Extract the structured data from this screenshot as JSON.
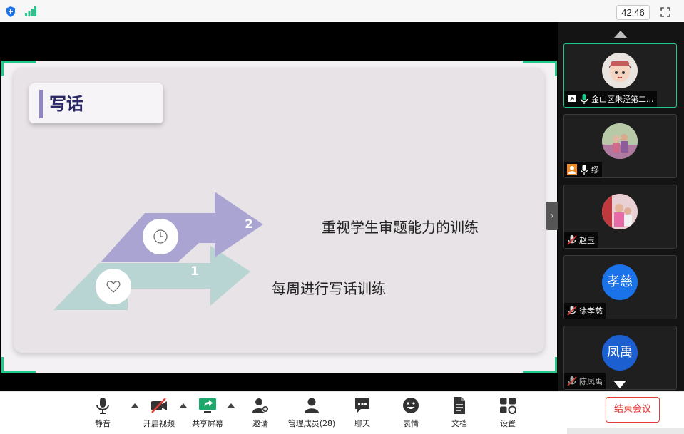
{
  "topbar": {
    "timer": "42:46",
    "icons": [
      "shield-icon",
      "signal-icon",
      "fullscreen-icon"
    ],
    "accent": "#1fc98a"
  },
  "slide": {
    "title": "写话",
    "arrow_1_number": "1",
    "arrow_2_number": "2",
    "point_1": "每周进行写话训练",
    "point_2": "重视学生审题能力的训练",
    "colors": {
      "arrow_1": "#b8d5d3",
      "arrow_2": "#aaa4d2",
      "title_bar": "#8f86c4",
      "title_text": "#2a2866"
    }
  },
  "participants": [
    {
      "name": "金山区朱泾第二...",
      "avatar": "cartoon-avatar",
      "active": true,
      "mic": "on",
      "icon": "share-icon"
    },
    {
      "name": "缪",
      "avatar": "photo-avatar",
      "active": false,
      "mic": "on",
      "icon": "host-icon"
    },
    {
      "name": "赵玉",
      "avatar": "photo-avatar",
      "active": false,
      "mic": "muted"
    },
    {
      "name": "徐孝慈",
      "avatar_text": "孝慈",
      "active": false,
      "mic": "muted"
    },
    {
      "name": "陈凤禹",
      "avatar_text": "凤禹",
      "active": false,
      "mic": "muted"
    }
  ],
  "toolbar": {
    "mute_label": "静音",
    "video_label": "开启视频",
    "share_label": "共享屏幕",
    "invite_label": "邀请",
    "members_label": "管理成员(28)",
    "chat_label": "聊天",
    "emoji_label": "表情",
    "docs_label": "文档",
    "settings_label": "设置",
    "end_label": "结束会议",
    "end_color": "#e53935"
  }
}
